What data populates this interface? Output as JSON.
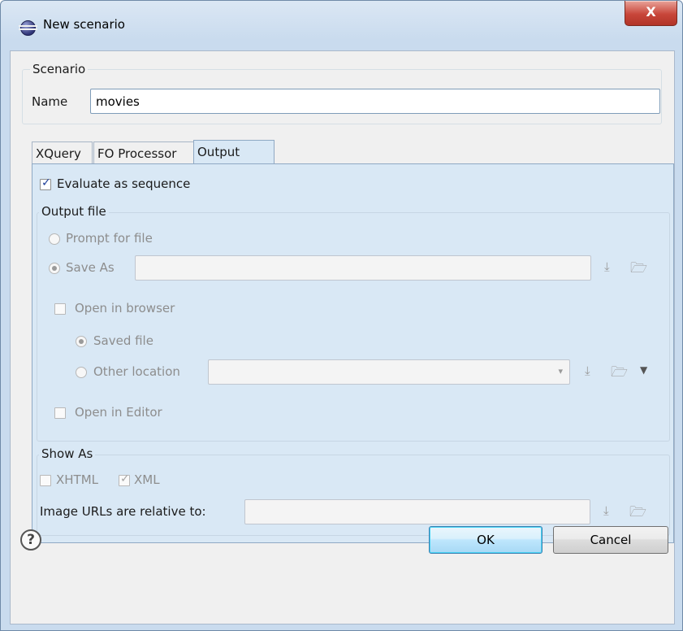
{
  "window": {
    "title": "New scenario",
    "close_glyph": "X",
    "app_icon": "eclipse-icon"
  },
  "scenario_group": {
    "title": "Scenario",
    "name_label": "Name",
    "name_value": "movies"
  },
  "tabs": [
    {
      "label": "XQuery",
      "active": false
    },
    {
      "label": "FO Processor",
      "active": false
    },
    {
      "label": "Output",
      "active": true
    }
  ],
  "output_tab": {
    "evaluate_as_sequence": {
      "label": "Evaluate as sequence",
      "checked": true
    },
    "output_file": {
      "title": "Output file",
      "prompt_for_file": {
        "label": "Prompt for file",
        "selected": false
      },
      "save_as": {
        "label": "Save As",
        "selected": true,
        "value": ""
      },
      "open_in_browser": {
        "label": "Open in browser",
        "checked": false
      },
      "saved_file": {
        "label": "Saved file",
        "selected": true
      },
      "other_location": {
        "label": "Other location",
        "selected": false,
        "value": ""
      },
      "open_in_editor": {
        "label": "Open in Editor",
        "checked": false
      }
    },
    "show_as": {
      "title": "Show As",
      "xhtml": {
        "label": "XHTML",
        "checked": false
      },
      "xml": {
        "label": "XML",
        "checked": true
      },
      "image_urls_label": "Image URLs are relative to:",
      "image_urls_value": ""
    }
  },
  "icons": {
    "insert_editor_variables": "insert-variables-icon",
    "browse_folder": "folder-icon",
    "dropdown": "dropdown-arrow-icon"
  },
  "buttons": {
    "help": "?",
    "ok": "OK",
    "cancel": "Cancel"
  },
  "colors": {
    "panel_bg": "#d9e8f5",
    "dialog_bg": "#f0f0f0",
    "titlebar_bg": "#c9dbee",
    "close_button": "#c8463a",
    "ok_button": "#bee6fd"
  }
}
